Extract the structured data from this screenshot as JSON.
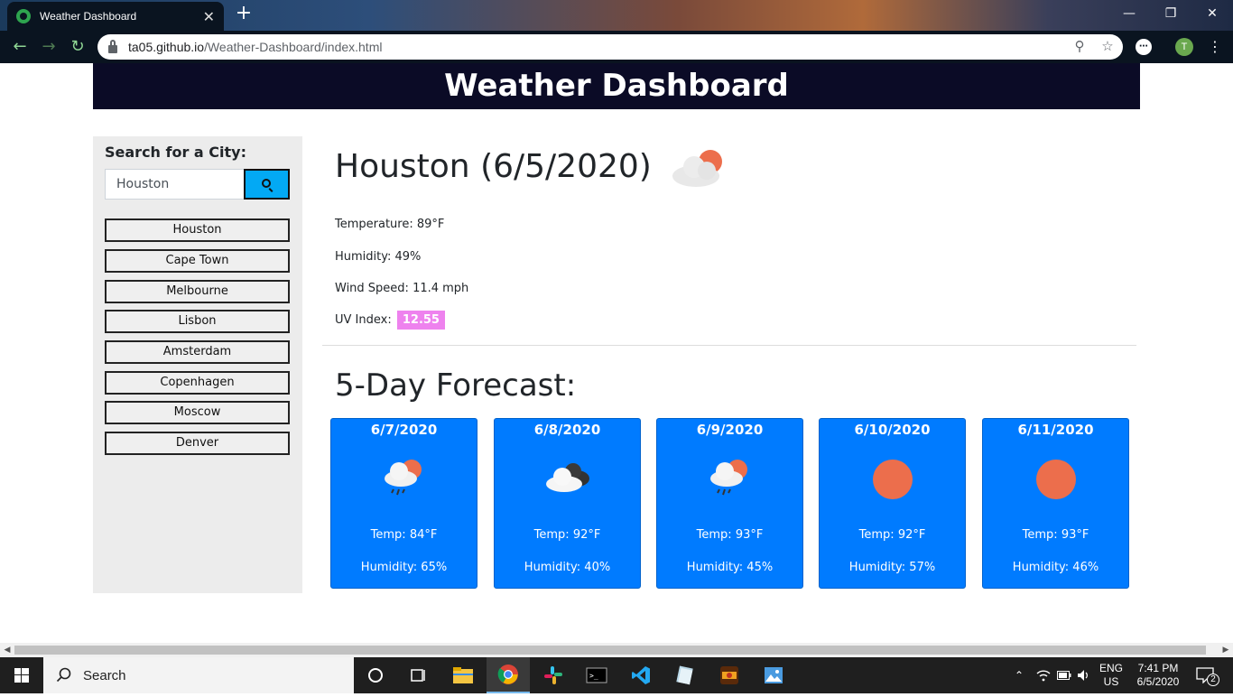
{
  "browser": {
    "tab_title": "Weather Dashboard",
    "tab_close": "✕",
    "new_tab": "+",
    "url_host": "ta05.github.io",
    "url_path": "/Weather-Dashboard/index.html",
    "profile_initial": "T"
  },
  "page": {
    "header_title": "Weather Dashboard",
    "search_label": "Search for a City:",
    "search_value": "Houston",
    "cities": [
      "Houston",
      "Cape Town",
      "Melbourne",
      "Lisbon",
      "Amsterdam",
      "Copenhagen",
      "Moscow",
      "Denver"
    ],
    "current": {
      "title": "Houston (6/5/2020)",
      "icon": "partly-cloudy-icon",
      "temperature": "Temperature: 89°F",
      "humidity": "Humidity: 49%",
      "wind": "Wind Speed: 11.4 mph",
      "uv_label": "UV Index:",
      "uv_value": "12.55",
      "uv_color": "#ee82ee"
    },
    "forecast_title": "5-Day Forecast:",
    "forecast": [
      {
        "date": "6/7/2020",
        "icon": "rain-sun-icon",
        "temp": "Temp: 84°F",
        "humidity": "Humidity: 65%"
      },
      {
        "date": "6/8/2020",
        "icon": "cloudy-icon",
        "temp": "Temp: 92°F",
        "humidity": "Humidity: 40%"
      },
      {
        "date": "6/9/2020",
        "icon": "rain-sun-icon",
        "temp": "Temp: 93°F",
        "humidity": "Humidity: 45%"
      },
      {
        "date": "6/10/2020",
        "icon": "sun-icon",
        "temp": "Temp: 92°F",
        "humidity": "Humidity: 57%"
      },
      {
        "date": "6/11/2020",
        "icon": "sun-icon",
        "temp": "Temp: 93°F",
        "humidity": "Humidity: 46%"
      }
    ],
    "card_color": "#007bff",
    "header_color": "#0b0b26"
  },
  "taskbar": {
    "search_placeholder": "Search",
    "lang_top": "ENG",
    "lang_bottom": "US",
    "time": "7:41 PM",
    "date": "6/5/2020",
    "notifications": "2"
  }
}
